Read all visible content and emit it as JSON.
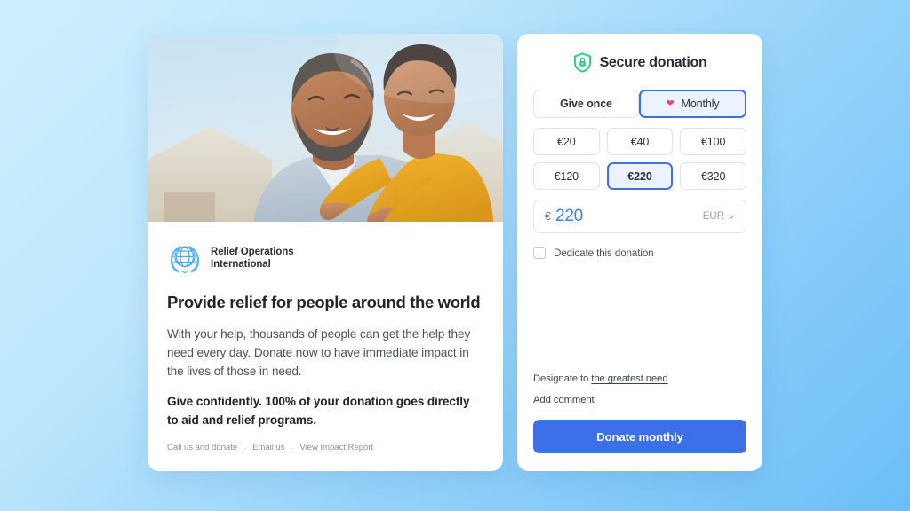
{
  "background": {
    "from": "#cdeffd",
    "to": "#6cbef8"
  },
  "left": {
    "hero_alt": "smiling man giving a child a piggyback ride outdoors",
    "org": {
      "logo_icon": "un-globe-laurel-icon",
      "name_line1": "Relief Operations",
      "name_line2": "International"
    },
    "headline": "Provide relief for people around the world",
    "paragraph": "With your help, thousands of people can get the help they need every day. Donate now to have immediate impact in the lives of those in need.",
    "paragraph_bold": "Give confidently. 100% of your donation goes directly to aid and relief programs.",
    "footer_links": [
      "Call us and donate",
      "Email us",
      "View Impact Report"
    ],
    "footer_separator": "·"
  },
  "right": {
    "secure": {
      "icon": "shield-lock-icon",
      "title": "Secure donation",
      "icon_color": "#2ecb82"
    },
    "frequency": {
      "options": [
        {
          "label": "Give once",
          "selected": false,
          "icon": null
        },
        {
          "label": "Monthly",
          "selected": true,
          "icon": "heart-icon"
        }
      ],
      "heart_color": "#f4436c",
      "accent": "#3f6fe5"
    },
    "amounts": [
      {
        "label": "€20",
        "selected": false
      },
      {
        "label": "€40",
        "selected": false
      },
      {
        "label": "€100",
        "selected": false
      },
      {
        "label": "€120",
        "selected": false
      },
      {
        "label": "€220",
        "selected": true
      },
      {
        "label": "€320",
        "selected": false
      }
    ],
    "amount_input": {
      "currency_symbol": "€",
      "value": "220",
      "placeholder": "0",
      "currency_code": "EUR",
      "chevron_icon": "chevron-down-icon"
    },
    "dedicate": {
      "label": "Dedicate this donation",
      "checked": false
    },
    "designate": {
      "prefix": "Designate to ",
      "link": "the greatest need"
    },
    "add_comment": "Add comment",
    "submit": {
      "label": "Donate monthly",
      "color": "#3d6fe8"
    }
  }
}
